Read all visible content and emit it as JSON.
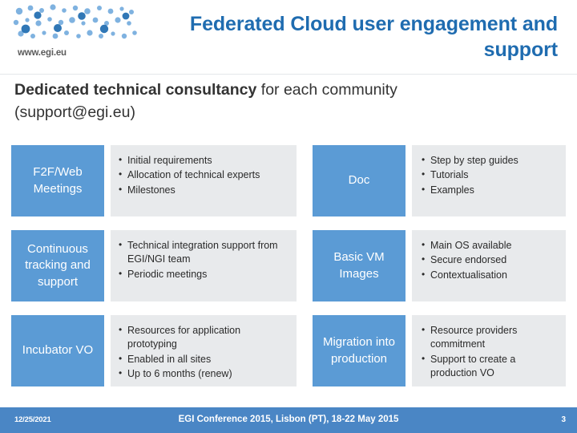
{
  "header": {
    "logo_url": "www.egi.eu",
    "logo_alt": "EGI",
    "title": "Federated Cloud user engagement and support"
  },
  "subtitle": {
    "bold_part": "Dedicated technical consultancy",
    "rest_part": " for each community",
    "line2": "(support@egi.eu)"
  },
  "grid": {
    "rows": [
      {
        "left_label": "F2F/Web Meetings",
        "left_bullets": [
          "Initial requirements",
          "Allocation of technical experts",
          "Milestones"
        ],
        "right_label": "Doc",
        "right_bullets": [
          "Step by step guides",
          "Tutorials",
          "Examples"
        ]
      },
      {
        "left_label": "Continuous tracking and support",
        "left_bullets": [
          "Technical integration support from EGI/NGI team",
          "Periodic meetings"
        ],
        "right_label": "Basic VM Images",
        "right_bullets": [
          "Main OS available",
          "Secure endorsed",
          "Contextualisation"
        ]
      },
      {
        "left_label": "Incubator VO",
        "left_bullets": [
          "Resources for application prototyping",
          "Enabled in all sites",
          "Up to 6 months (renew)"
        ],
        "right_label": "Migration into production",
        "right_bullets": [
          "Resource providers commitment",
          "Support to create a production VO"
        ]
      }
    ]
  },
  "footer": {
    "date": "12/25/2021",
    "center": "EGI Conference 2015, Lisbon (PT), 18-22 May 2015",
    "page": "3"
  },
  "colors": {
    "accent_blue": "#5b9bd5",
    "title_blue": "#1f6cb0",
    "footer_blue": "#4a86c5",
    "panel_gray": "#e8eaec"
  }
}
